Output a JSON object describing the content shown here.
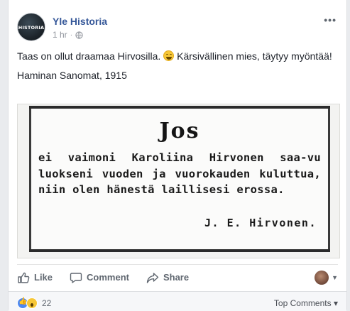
{
  "post": {
    "page_name": "Yle Historia",
    "avatar_text": "HISTORIA",
    "time": "1 hr",
    "text_line1": "Taas on ollut draamaa Hirvosilla.",
    "text_line1_rest": " Kärsivällinen mies, täytyy myöntää!",
    "text_line2": "Haminan Sanomat, 1915"
  },
  "clipping": {
    "title": "Jos",
    "body": "ei vaimoni Karoliina Hirvonen saa-vu luokseni vuoden ja vuorokauden kuluttua, niin olen hänestä laillisesi erossa.",
    "signature": "J. E. Hirvonen."
  },
  "actions": {
    "like": "Like",
    "comment": "Comment",
    "share": "Share"
  },
  "footer": {
    "reaction_count": "22",
    "top_comments": "Top Comments"
  },
  "icons": [
    "globe-icon",
    "more-icon",
    "like-icon",
    "comment-icon",
    "share-icon",
    "chevron-down-icon"
  ]
}
